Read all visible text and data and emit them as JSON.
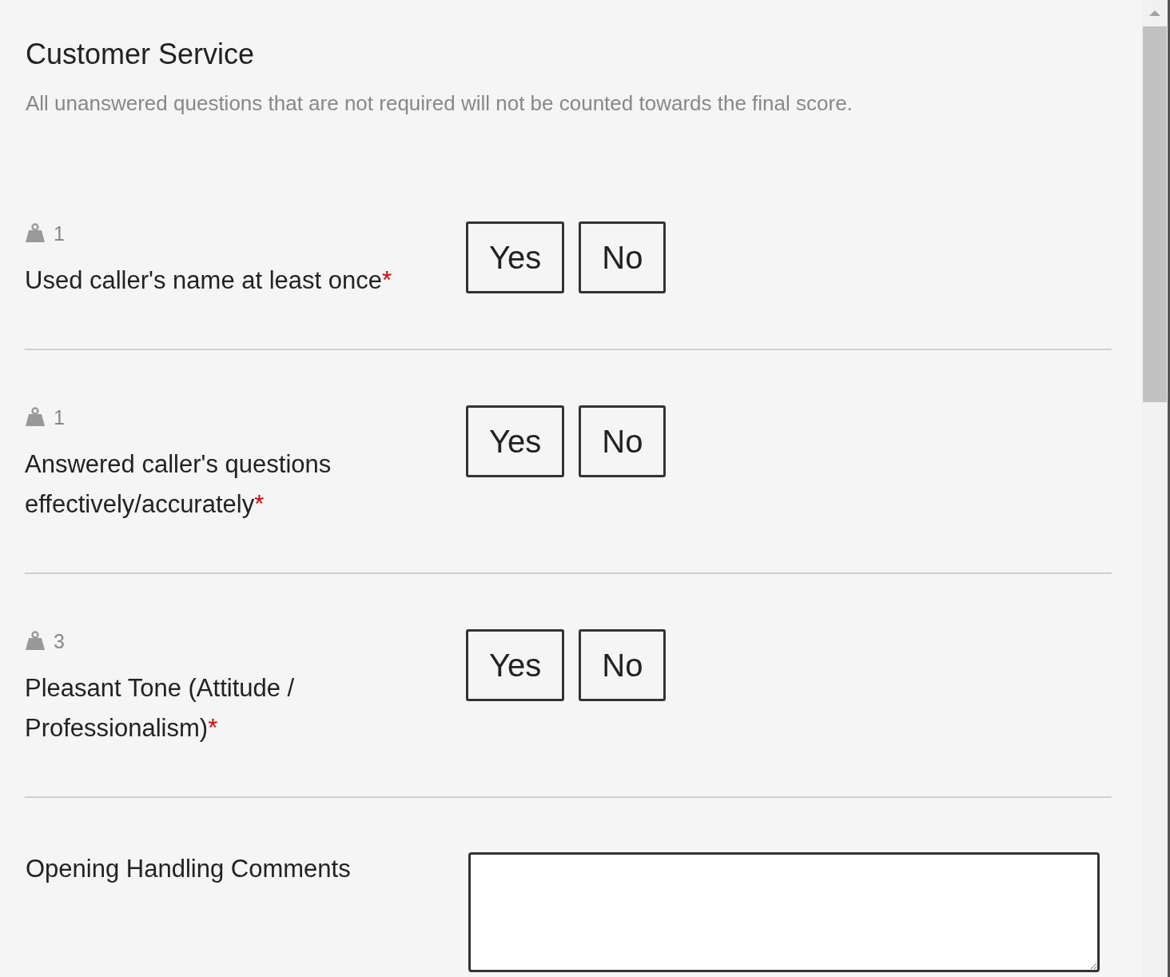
{
  "section": {
    "title": "Customer Service",
    "note": "All unanswered questions that are not required will not be counted towards the final score."
  },
  "questions": [
    {
      "weight": "1",
      "text": "Used caller's name at least once",
      "required_mark": "*",
      "options": [
        {
          "label": "Yes",
          "selected": false
        },
        {
          "label": "No",
          "selected": false
        }
      ]
    },
    {
      "weight": "1",
      "text": "Answered caller's questions effectively/accurately",
      "required_mark": "*",
      "options": [
        {
          "label": "Yes",
          "selected": false
        },
        {
          "label": "No",
          "selected": false
        }
      ]
    },
    {
      "weight": "3",
      "text": "Pleasant Tone (Attitude / Professionalism)",
      "required_mark": "*",
      "options": [
        {
          "label": "Yes",
          "selected": false
        },
        {
          "label": "No",
          "selected": false
        }
      ]
    }
  ],
  "comments": {
    "label": "Opening Handling Comments"
  }
}
